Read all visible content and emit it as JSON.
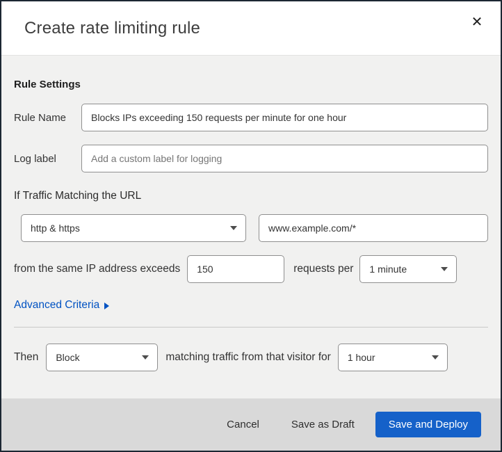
{
  "modal": {
    "title": "Create rate limiting rule",
    "close_icon": "✕"
  },
  "rule_settings": {
    "section_title": "Rule Settings",
    "rule_name": {
      "label": "Rule Name",
      "value": "Blocks IPs exceeding 150 requests per minute for one hour"
    },
    "log_label": {
      "label": "Log label",
      "placeholder": "Add a custom label for logging"
    }
  },
  "traffic_match": {
    "heading": "If Traffic Matching the URL",
    "scheme_select": {
      "selected": "http & https"
    },
    "url_input": {
      "value": "www.example.com/*"
    },
    "threshold": {
      "prefix_text": "from the same IP address exceeds",
      "count_value": "150",
      "middle_text": "requests per",
      "period_select": {
        "selected": "1 minute"
      }
    },
    "advanced_link": {
      "label": "Advanced Criteria"
    }
  },
  "action": {
    "then_label": "Then",
    "action_select": {
      "selected": "Block"
    },
    "middle_text": "matching traffic from that visitor for",
    "duration_select": {
      "selected": "1 hour"
    }
  },
  "footer": {
    "cancel_label": "Cancel",
    "save_draft_label": "Save as Draft",
    "save_deploy_label": "Save and Deploy"
  },
  "colors": {
    "primary_button": "#1561c9",
    "link_blue": "#0052c2",
    "body_bg": "#f1f1f0",
    "footer_bg": "#d9d9d9",
    "frame_border": "#1c2733"
  }
}
